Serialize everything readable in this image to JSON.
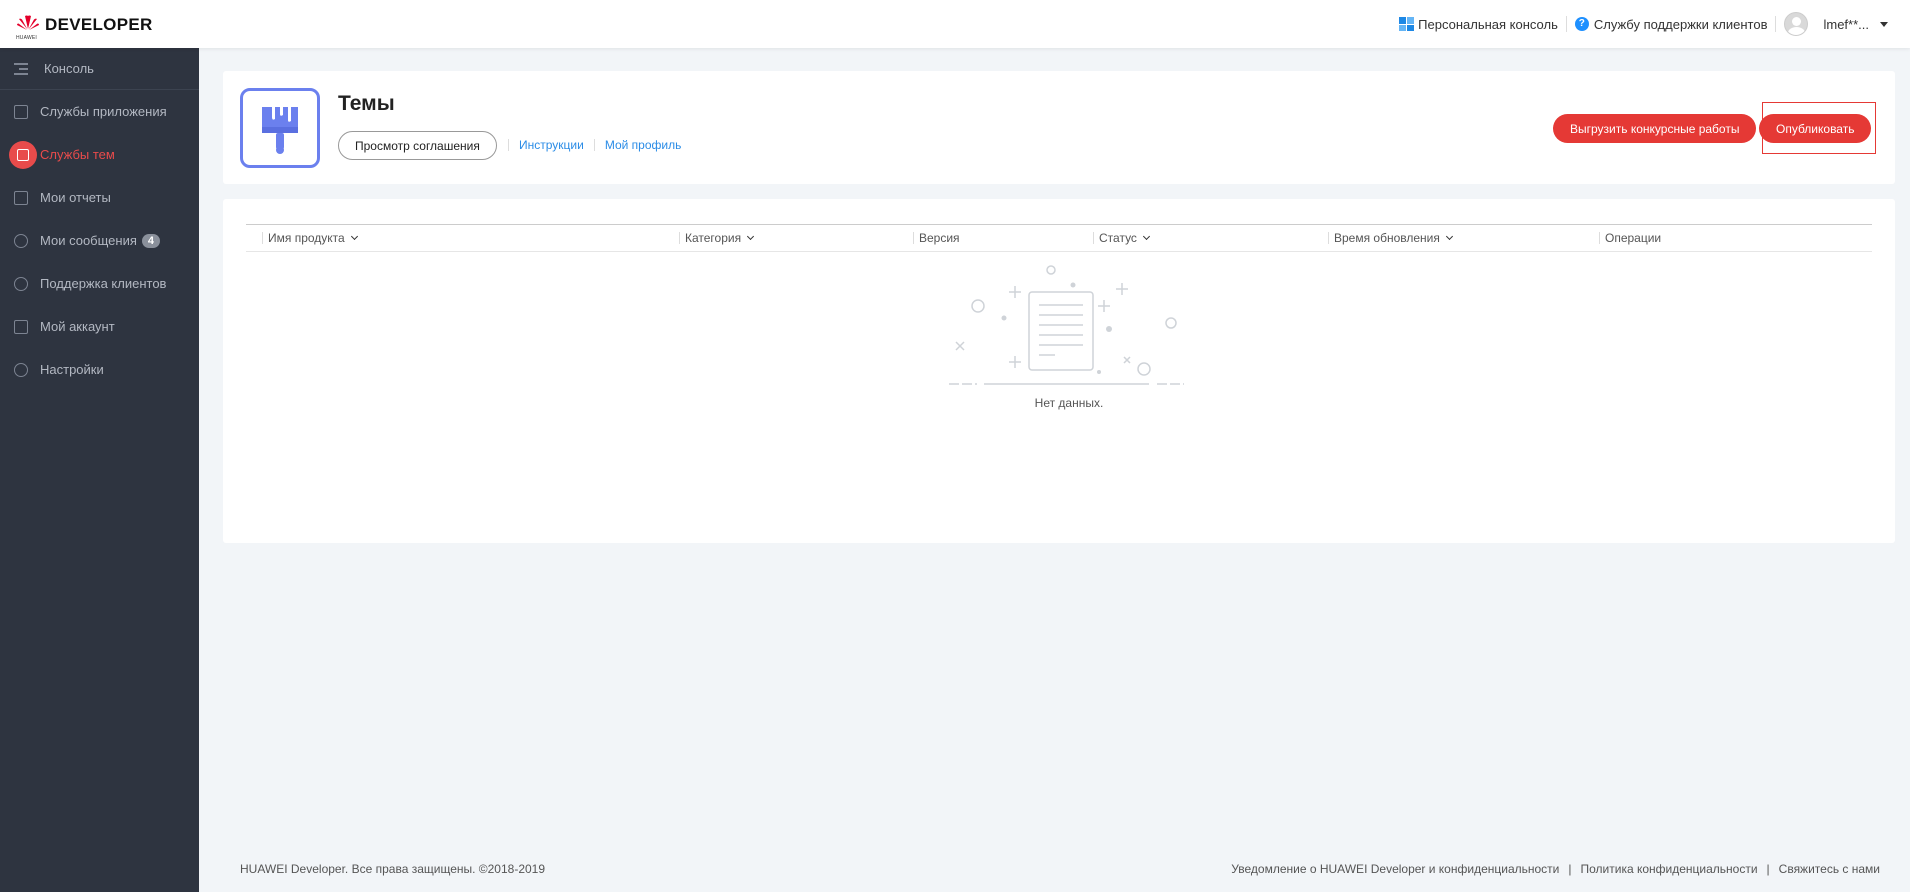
{
  "brand": {
    "name": "DEVELOPER",
    "sub": "HUAWEI"
  },
  "topbar": {
    "console_label": "Персональная консоль",
    "support_label": "Службу поддержки клиентов",
    "user_name": "lmef**..."
  },
  "sidebar": {
    "header": "Консоль",
    "items": [
      {
        "label": "Службы приложения"
      },
      {
        "label": "Службы тем",
        "active": true
      },
      {
        "label": "Мои отчеты"
      },
      {
        "label": "Мои сообщения",
        "badge": "4"
      },
      {
        "label": "Поддержка клиентов"
      },
      {
        "label": "Мой аккаунт"
      },
      {
        "label": "Настройки"
      }
    ]
  },
  "header": {
    "title": "Темы",
    "agreement_button": "Просмотр соглашения",
    "links": [
      "Инструкции",
      "Мой профиль"
    ],
    "upload_button": "Выгрузить конкурсные работы",
    "publish_button": "Опубликовать"
  },
  "table": {
    "columns": [
      "Имя продукта",
      "Категория",
      "Версия",
      "Статус",
      "Время обновления",
      "Операции"
    ],
    "rows": [],
    "empty_text": "Нет данных."
  },
  "footer": {
    "copyright": "HUAWEI Developer. Все права защищены. ©2018-2019",
    "links": [
      "Уведомление о HUAWEI Developer и конфиденциальности",
      "Политика конфиденциальности",
      "Свяжитесь с нами"
    ],
    "separator": "|"
  },
  "colors": {
    "accent": "#e53935",
    "sidebar_bg": "#2e3440",
    "link": "#2b8ce6",
    "theme_icon": "#6b80ee"
  }
}
